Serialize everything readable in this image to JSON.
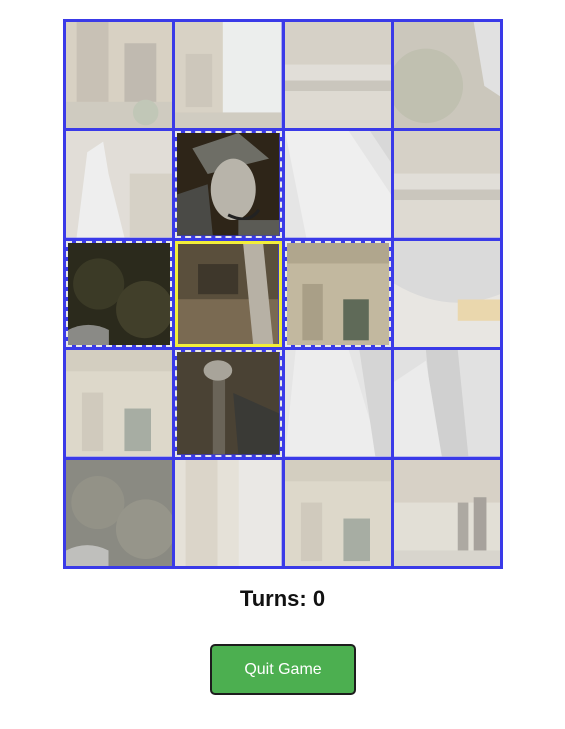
{
  "game": {
    "turns_label": "Turns:",
    "turns": "0",
    "quit_label": "Quit Game",
    "grid": {
      "columns": 4,
      "rows": 5
    }
  },
  "tiles": [
    {
      "state": "faded",
      "scene": "building-ornate"
    },
    {
      "state": "faded",
      "scene": "tower-sky"
    },
    {
      "state": "faded",
      "scene": "stone-ledge"
    },
    {
      "state": "faded",
      "scene": "foliage-statue"
    },
    {
      "state": "faded",
      "scene": "raised-hand"
    },
    {
      "state": "revealed",
      "scene": "man-with-pipe"
    },
    {
      "state": "faded",
      "scene": "arm-sleeve"
    },
    {
      "state": "faded",
      "scene": "stone-ledge"
    },
    {
      "state": "revealed",
      "scene": "dark-foliage"
    },
    {
      "state": "selected",
      "scene": "hand-on-building"
    },
    {
      "state": "revealed",
      "scene": "building-window"
    },
    {
      "state": "faded",
      "scene": "figure-shoulder"
    },
    {
      "state": "faded",
      "scene": "building-window"
    },
    {
      "state": "revealed",
      "scene": "cane-hand"
    },
    {
      "state": "faded",
      "scene": "jacket-lapel"
    },
    {
      "state": "faded",
      "scene": "jacket-tie"
    },
    {
      "state": "faded",
      "scene": "dark-foliage"
    },
    {
      "state": "faded",
      "scene": "tower-base"
    },
    {
      "state": "faded",
      "scene": "building-window"
    },
    {
      "state": "faded",
      "scene": "street-people"
    }
  ],
  "colors": {
    "grid_border": "#3a3ae8",
    "selected_border": "#f2ee3a",
    "button": "#4caf50"
  }
}
